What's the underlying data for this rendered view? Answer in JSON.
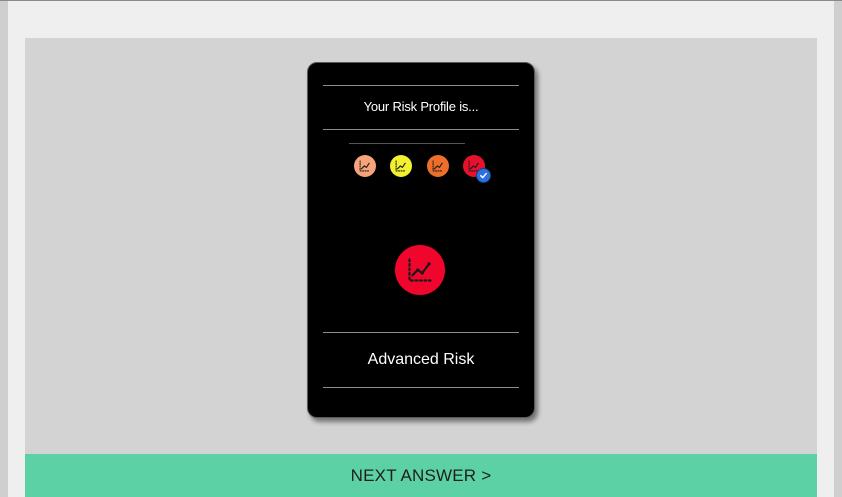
{
  "card": {
    "title": "Your Risk Profile is...",
    "result_label": "Advanced Risk"
  },
  "levels": [
    {
      "icon": "chart-growth-icon",
      "color": "#f7a47a",
      "selected": false
    },
    {
      "icon": "chart-growth-icon",
      "color": "#f3f02f",
      "selected": false
    },
    {
      "icon": "chart-growth-icon",
      "color": "#ee6f2a",
      "selected": false
    },
    {
      "icon": "chart-growth-icon",
      "color": "#e8112d",
      "selected": true
    }
  ],
  "result_icon": {
    "icon": "chart-growth-icon",
    "color": "#f0062c"
  },
  "selected_badge_icon": "checkmark-icon",
  "next_button": {
    "label": "NEXT ANSWER >",
    "color": "#5cd1a6"
  }
}
